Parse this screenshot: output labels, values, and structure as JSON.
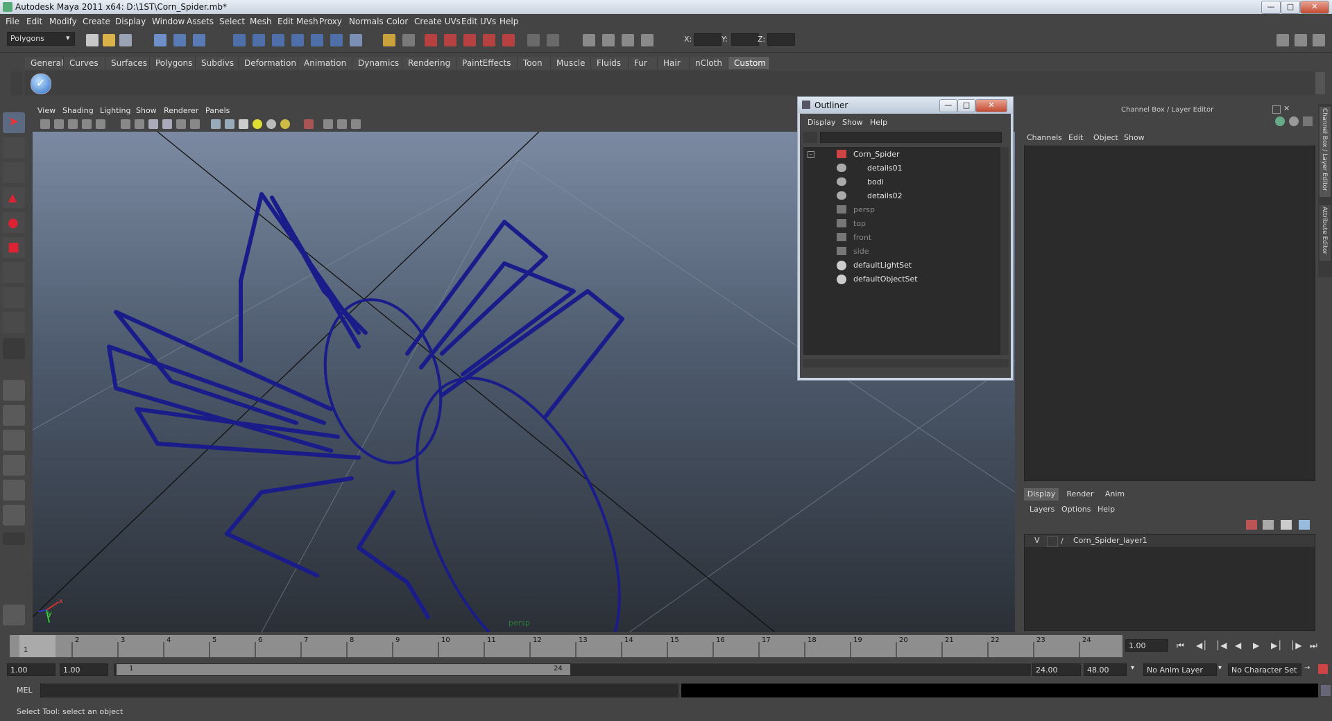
{
  "window": {
    "title": "Autodesk Maya 2011 x64: D:\\1ST\\Corn_Spider.mb*"
  },
  "menubar": [
    "File",
    "Edit",
    "Modify",
    "Create",
    "Display",
    "Window",
    "Assets",
    "Select",
    "Mesh",
    "Edit Mesh",
    "Proxy",
    "Normals",
    "Color",
    "Create UVs",
    "Edit UVs",
    "Help"
  ],
  "status_line": {
    "mode": "Polygons",
    "x_label": "X:",
    "y_label": "Y:",
    "z_label": "Z:"
  },
  "shelf": {
    "tabs": [
      "General",
      "Curves",
      "Surfaces",
      "Polygons",
      "Subdivs",
      "Deformation",
      "Animation",
      "Dynamics",
      "Rendering",
      "PaintEffects",
      "Toon",
      "Muscle",
      "Fluids",
      "Fur",
      "Hair",
      "nCloth",
      "Custom"
    ],
    "active": "Custom"
  },
  "viewport": {
    "menu": [
      "View",
      "Shading",
      "Lighting",
      "Show",
      "Renderer",
      "Panels"
    ],
    "camera_label": "persp",
    "axis_x": "x",
    "axis_y": "y"
  },
  "outliner": {
    "title": "Outliner",
    "menu": [
      "Display",
      "Show",
      "Help"
    ],
    "items": [
      {
        "label": "Corn_Spider",
        "dim": false
      },
      {
        "label": "details01",
        "dim": false
      },
      {
        "label": "bodi",
        "dim": false
      },
      {
        "label": "details02",
        "dim": false
      },
      {
        "label": "persp",
        "dim": true
      },
      {
        "label": "top",
        "dim": true
      },
      {
        "label": "front",
        "dim": true
      },
      {
        "label": "side",
        "dim": true
      },
      {
        "label": "defaultLightSet",
        "dim": false
      },
      {
        "label": "defaultObjectSet",
        "dim": false
      }
    ]
  },
  "channel_box": {
    "title": "Channel Box / Layer Editor",
    "menu": [
      "Channels",
      "Edit",
      "Object",
      "Show"
    ],
    "side_tabs": [
      "Channel Box / Layer Editor",
      "Attribute Editor"
    ]
  },
  "layer_editor": {
    "tabs": [
      "Display",
      "Render",
      "Anim"
    ],
    "active_tab": "Display",
    "menu": [
      "Layers",
      "Options",
      "Help"
    ],
    "layer": {
      "visibility": "V",
      "name": "Corn_Spider_layer1"
    }
  },
  "timeline": {
    "ticks": [
      "1",
      "2",
      "3",
      "4",
      "5",
      "6",
      "7",
      "8",
      "9",
      "10",
      "11",
      "12",
      "13",
      "14",
      "15",
      "16",
      "17",
      "18",
      "19",
      "20",
      "21",
      "22",
      "23",
      "24"
    ],
    "current_frame": "1",
    "current_time_field": "1.00"
  },
  "range_slider": {
    "start_time": "1.00",
    "playback_start": "1.00",
    "range_start_label": "1",
    "range_end_label": "24",
    "playback_end": "24.00",
    "end_time": "48.00",
    "anim_layer": "No Anim Layer",
    "character_set": "No Character Set"
  },
  "command_line": {
    "label": "MEL"
  },
  "help_line": {
    "text": "Select Tool: select an object"
  }
}
